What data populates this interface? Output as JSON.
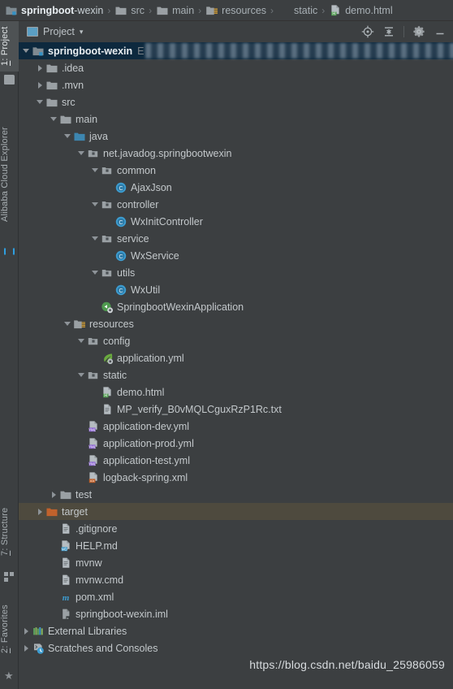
{
  "breadcrumb": {
    "items": [
      {
        "label": "springboot-wexin",
        "bold_part": "springboot",
        "icon": "module-folder-icon"
      },
      {
        "label": "src",
        "icon": "folder-icon"
      },
      {
        "label": "main",
        "icon": "folder-icon"
      },
      {
        "label": "resources",
        "icon": "resources-folder-icon"
      },
      {
        "label": "static",
        "icon": "package-folder-icon"
      },
      {
        "label": "demo.html",
        "icon": "html-file-icon"
      }
    ],
    "separator": "›"
  },
  "rail": {
    "tabs": [
      {
        "label": "1: Project",
        "active": true,
        "icon": "folder-icon"
      },
      {
        "label": "Alibaba Cloud Explorer",
        "active": false,
        "icon": "cloud-icon"
      },
      {
        "label": "7: Structure",
        "active": false,
        "icon": "structure-icon"
      },
      {
        "label": "2: Favorites",
        "active": false,
        "icon": "star-icon"
      }
    ]
  },
  "tool_window": {
    "title": "Project",
    "dropdown_arrow": "▾",
    "actions": [
      {
        "name": "locate-in-tree",
        "label": "Select Opened File"
      },
      {
        "name": "collapse-all",
        "label": "Collapse All"
      },
      {
        "name": "settings",
        "label": "Settings"
      },
      {
        "name": "hide",
        "label": "Hide"
      }
    ]
  },
  "tree": {
    "rows": [
      {
        "indent": 0,
        "twisty": "open",
        "icon": "module-folder-icon",
        "label": "springboot-wexin",
        "sub": "E",
        "selected": "blue",
        "redacted": true
      },
      {
        "indent": 1,
        "twisty": "closed",
        "icon": "folder-icon",
        "label": ".idea"
      },
      {
        "indent": 1,
        "twisty": "closed",
        "icon": "folder-icon",
        "label": ".mvn"
      },
      {
        "indent": 1,
        "twisty": "open",
        "icon": "folder-icon",
        "label": "src"
      },
      {
        "indent": 2,
        "twisty": "open",
        "icon": "folder-icon",
        "label": "main"
      },
      {
        "indent": 3,
        "twisty": "open",
        "icon": "source-folder-icon",
        "label": "java"
      },
      {
        "indent": 4,
        "twisty": "open",
        "icon": "package-icon",
        "label": "net.javadog.springbootwexin"
      },
      {
        "indent": 5,
        "twisty": "open",
        "icon": "package-icon",
        "label": "common"
      },
      {
        "indent": 6,
        "twisty": "none",
        "icon": "java-class-icon",
        "label": "AjaxJson"
      },
      {
        "indent": 5,
        "twisty": "open",
        "icon": "package-icon",
        "label": "controller"
      },
      {
        "indent": 6,
        "twisty": "none",
        "icon": "java-class-icon",
        "label": "WxInitController"
      },
      {
        "indent": 5,
        "twisty": "open",
        "icon": "package-icon",
        "label": "service"
      },
      {
        "indent": 6,
        "twisty": "none",
        "icon": "java-class-icon",
        "label": "WxService"
      },
      {
        "indent": 5,
        "twisty": "open",
        "icon": "package-icon",
        "label": "utils"
      },
      {
        "indent": 6,
        "twisty": "none",
        "icon": "java-class-icon",
        "label": "WxUtil"
      },
      {
        "indent": 5,
        "twisty": "none",
        "icon": "spring-boot-run-icon",
        "label": "SpringbootWexinApplication"
      },
      {
        "indent": 3,
        "twisty": "open",
        "icon": "resources-folder-icon",
        "label": "resources"
      },
      {
        "indent": 4,
        "twisty": "open",
        "icon": "package-icon",
        "label": "config"
      },
      {
        "indent": 5,
        "twisty": "none",
        "icon": "spring-yml-icon",
        "label": "application.yml"
      },
      {
        "indent": 4,
        "twisty": "open",
        "icon": "package-icon",
        "label": "static"
      },
      {
        "indent": 5,
        "twisty": "none",
        "icon": "html-file-icon",
        "label": "demo.html"
      },
      {
        "indent": 5,
        "twisty": "none",
        "icon": "text-file-icon",
        "label": "MP_verify_B0vMQLCguxRzP1Rc.txt"
      },
      {
        "indent": 4,
        "twisty": "none",
        "icon": "yml-file-icon",
        "label": "application-dev.yml"
      },
      {
        "indent": 4,
        "twisty": "none",
        "icon": "yml-file-icon",
        "label": "application-prod.yml"
      },
      {
        "indent": 4,
        "twisty": "none",
        "icon": "yml-file-icon",
        "label": "application-test.yml"
      },
      {
        "indent": 4,
        "twisty": "none",
        "icon": "xml-file-icon",
        "label": "logback-spring.xml"
      },
      {
        "indent": 2,
        "twisty": "closed",
        "icon": "folder-icon",
        "label": "test"
      },
      {
        "indent": 1,
        "twisty": "closed",
        "icon": "excluded-folder-icon",
        "label": "target",
        "selected": "olive"
      },
      {
        "indent": 2,
        "twisty": "none",
        "icon": "text-file-icon",
        "label": ".gitignore"
      },
      {
        "indent": 2,
        "twisty": "none",
        "icon": "markdown-file-icon",
        "label": "HELP.md"
      },
      {
        "indent": 2,
        "twisty": "none",
        "icon": "text-file-icon",
        "label": "mvnw"
      },
      {
        "indent": 2,
        "twisty": "none",
        "icon": "text-file-icon",
        "label": "mvnw.cmd"
      },
      {
        "indent": 2,
        "twisty": "none",
        "icon": "maven-file-icon",
        "label": "pom.xml"
      },
      {
        "indent": 2,
        "twisty": "none",
        "icon": "iml-file-icon",
        "label": "springboot-wexin.iml"
      },
      {
        "indent": 0,
        "twisty": "closed",
        "icon": "external-libraries-icon",
        "label": "External Libraries"
      },
      {
        "indent": 0,
        "twisty": "closed",
        "icon": "scratches-icon",
        "label": "Scratches and Consoles"
      }
    ]
  },
  "watermark": {
    "text": "https://blog.csdn.net/baidu_25986059"
  },
  "colors": {
    "background": "#3c3f41",
    "selection_blue": "#0d293e",
    "selection_olive": "#4e4a3e",
    "text": "#c3c8cb",
    "accent_blue": "#3592c4",
    "folder_grey": "#9aa0a4",
    "folder_orange": "#c1622c",
    "yml_badge": "#8a63d2",
    "md_badge": "#3592c4",
    "html_badge": "#4f9a4f",
    "xml_badge": "#c1622c"
  }
}
